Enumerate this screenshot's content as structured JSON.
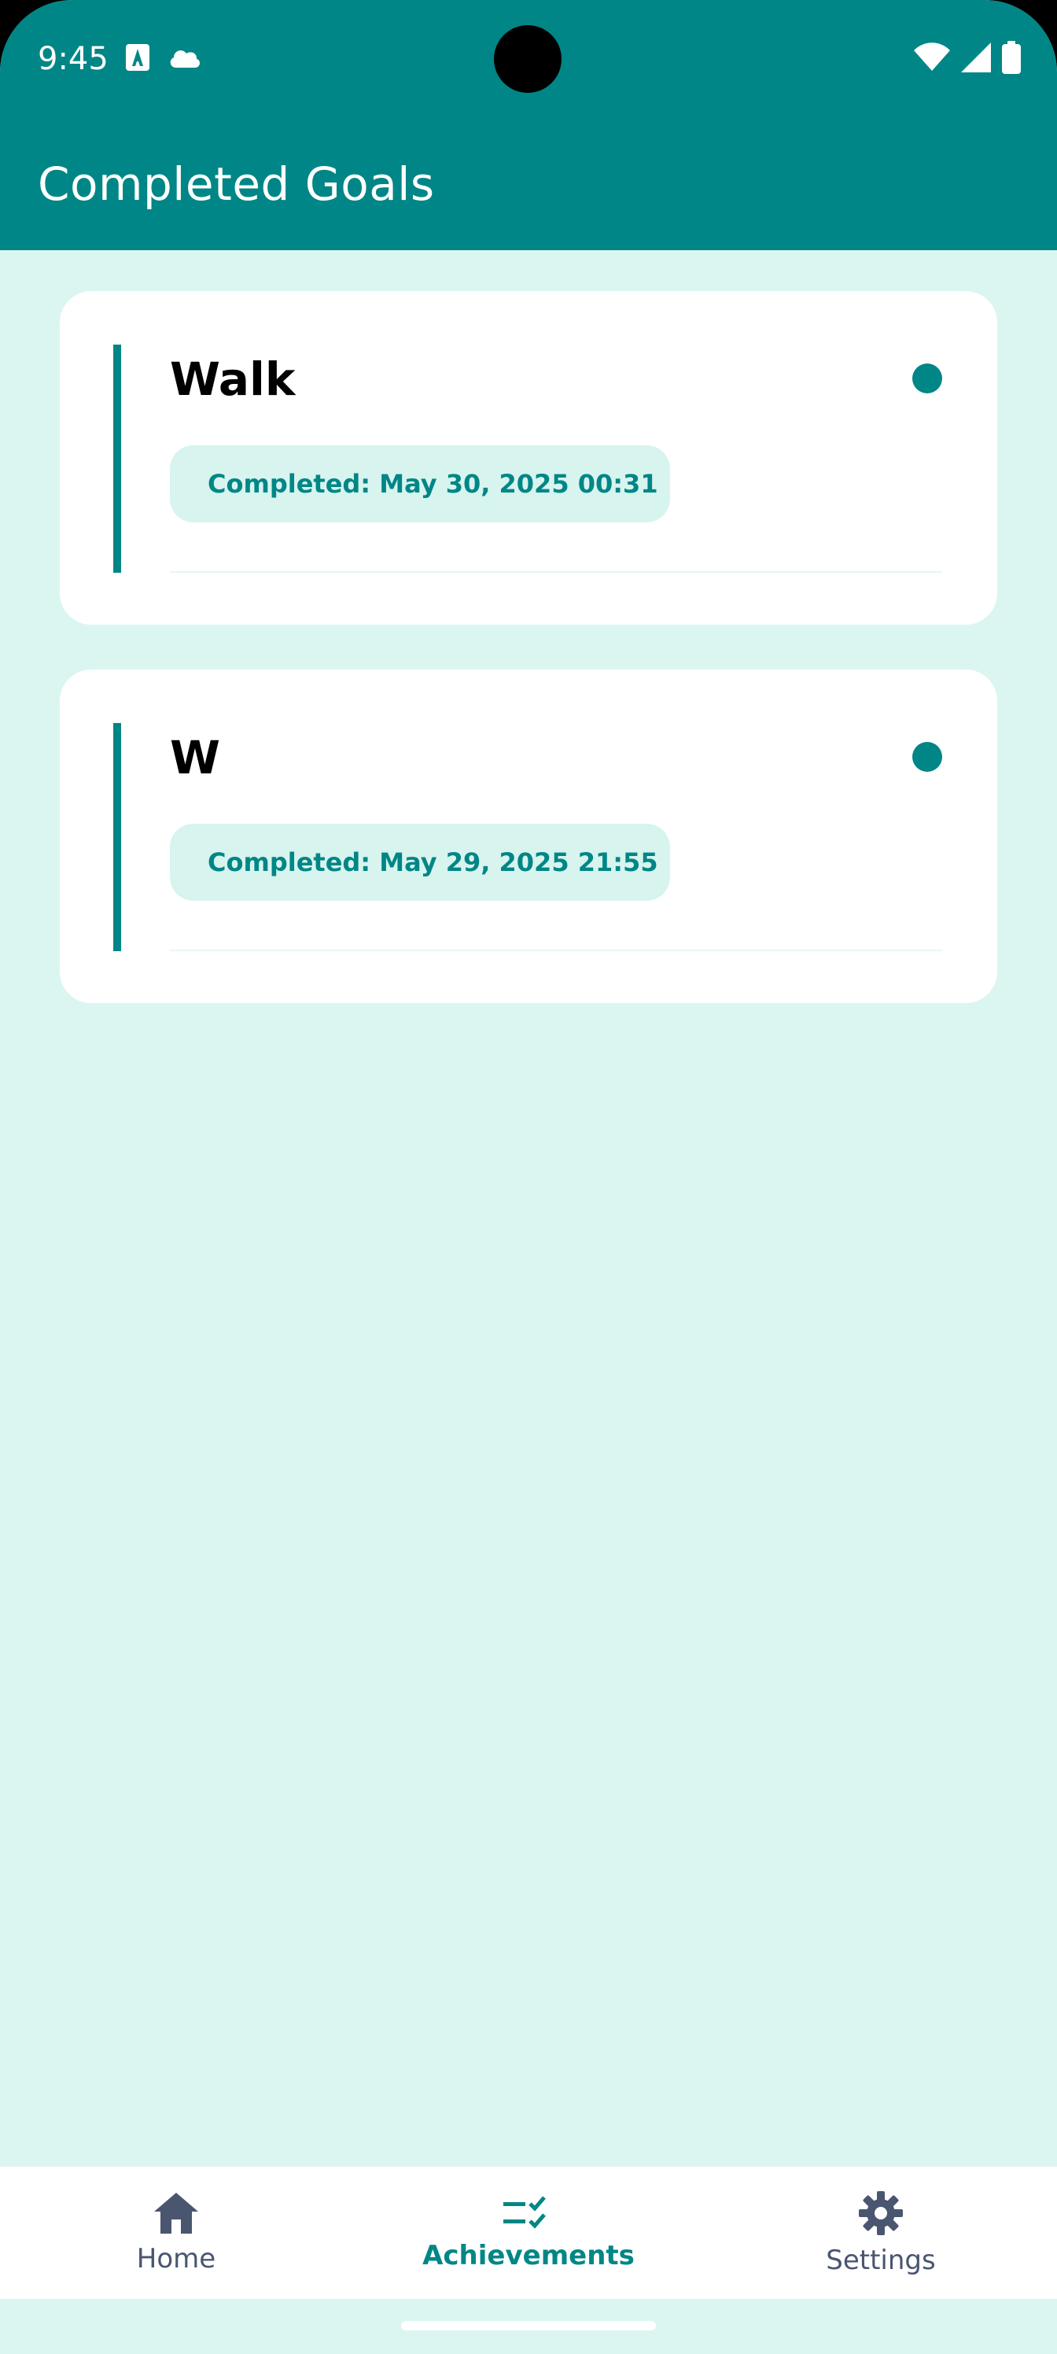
{
  "status_bar": {
    "time": "9:45",
    "icons_left": [
      "accessibility-a-icon",
      "cloud-icon"
    ],
    "icons_right": [
      "wifi-icon",
      "signal-icon",
      "battery-icon"
    ]
  },
  "app_bar": {
    "title": "Completed Goals"
  },
  "goals": [
    {
      "title": "Walk",
      "completed_label": "Completed: May 30, 2025 00:31"
    },
    {
      "title": "W",
      "completed_label": "Completed: May 29, 2025 21:55"
    }
  ],
  "nav": {
    "items": [
      {
        "label": "Home",
        "icon": "home-icon",
        "selected": false
      },
      {
        "label": "Achievements",
        "icon": "checklist-icon",
        "selected": true
      },
      {
        "label": "Settings",
        "icon": "gear-icon",
        "selected": false
      }
    ]
  },
  "colors": {
    "primary": "#008686",
    "background": "#dbf6f0",
    "pill": "#d7f4ef",
    "nav_inactive": "#4a5670"
  }
}
